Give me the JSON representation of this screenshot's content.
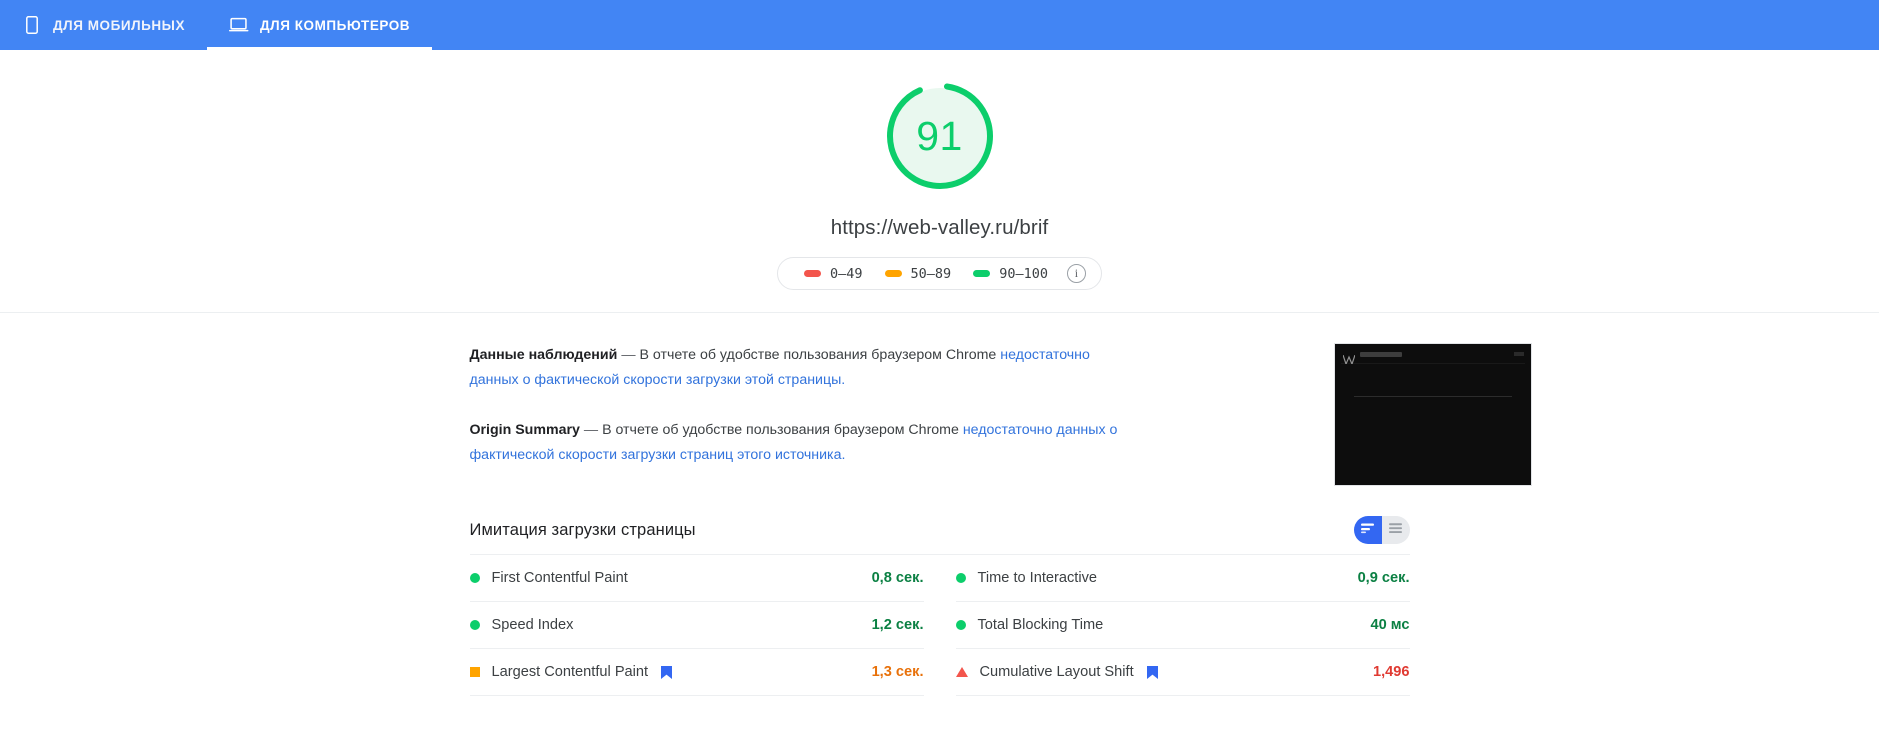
{
  "tabs": [
    {
      "label": "ДЛЯ МОБИЛЬНЫХ",
      "icon": "mobile-icon",
      "active": false
    },
    {
      "label": "ДЛЯ КОМПЬЮТЕРОВ",
      "icon": "desktop-icon",
      "active": true
    }
  ],
  "hero": {
    "score": "91",
    "score_max": 100,
    "score_color": "#0cce6b",
    "url": "https://web-valley.ru/brif",
    "legend": [
      {
        "range": "0–49",
        "color": "#f3554c",
        "shape": "red-bar"
      },
      {
        "range": "50–89",
        "color": "#ffa400",
        "shape": "orange-bar"
      },
      {
        "range": "90–100",
        "color": "#0cce6b",
        "shape": "green-bar"
      }
    ],
    "info_glyph": "i"
  },
  "field_data": {
    "observed": {
      "title": "Данные наблюдений",
      "dash": "—",
      "text_plain": "В отчете об удобстве пользования браузером Chrome ",
      "text_link": "недостаточно данных о фактической скорости загрузки этой страницы."
    },
    "origin": {
      "title": "Origin Summary",
      "dash": "—",
      "text_plain": "В отчете об удобстве пользования браузером Chrome ",
      "text_link": "недостаточно данных о фактической скорости загрузки страниц этого источника."
    }
  },
  "metrics_section": {
    "title": "Имитация загрузки страницы",
    "toggle": {
      "active": "bars-view",
      "options": [
        {
          "name": "bars-view",
          "icon": "bar-chart-icon",
          "selected": true
        },
        {
          "name": "list-view",
          "icon": "list-lines-icon",
          "selected": false
        }
      ]
    },
    "left_column": [
      {
        "name": "First Contentful Paint",
        "value": "0,8 сек.",
        "status": "good",
        "marker": "dot-green",
        "value_color": "#0b8043",
        "flag": false
      },
      {
        "name": "Speed Index",
        "value": "1,2 сек.",
        "status": "good",
        "marker": "dot-green",
        "value_color": "#0b8043",
        "flag": false
      },
      {
        "name": "Largest Contentful Paint",
        "value": "1,3 сек.",
        "status": "average",
        "marker": "square-orange",
        "value_color": "#e8710a",
        "flag": true
      }
    ],
    "right_column": [
      {
        "name": "Time to Interactive",
        "value": "0,9 сек.",
        "status": "good",
        "marker": "dot-green",
        "value_color": "#0b8043",
        "flag": false
      },
      {
        "name": "Total Blocking Time",
        "value": "40 мс",
        "status": "good",
        "marker": "dot-green",
        "value_color": "#0b8043",
        "flag": false
      },
      {
        "name": "Cumulative Layout Shift",
        "value": "1,496",
        "status": "poor",
        "marker": "triangle-red",
        "value_color": "#e03a32",
        "flag": true
      }
    ]
  },
  "colors": {
    "header_blue": "#4285f4",
    "good_green": "#0cce6b",
    "average_orange": "#ffa400",
    "poor_red": "#f3554c",
    "link_blue": "#3273dc",
    "toggle_active": "#3367f2"
  }
}
